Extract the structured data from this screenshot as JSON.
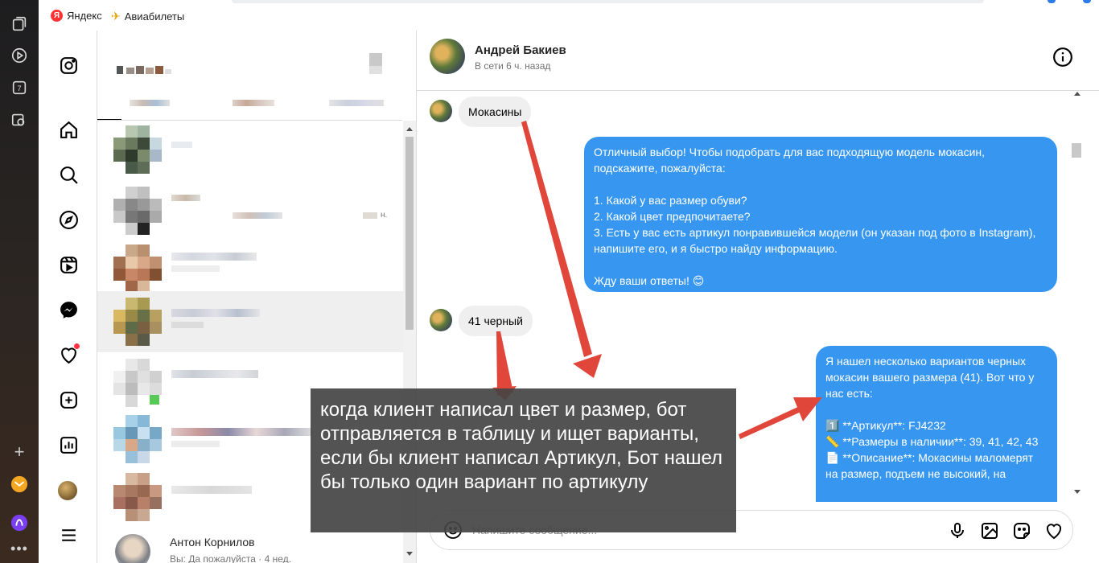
{
  "bookmarks": [
    {
      "label": "Яндекс",
      "icon": "yandex-logo-icon"
    },
    {
      "label": "Авиабилеты",
      "icon": "airplane-icon"
    }
  ],
  "chat": {
    "contact_name": "Андрей Бакиев",
    "contact_status": "В сети 6 ч. назад",
    "messages": [
      {
        "direction": "in",
        "text": "Мокасины"
      },
      {
        "direction": "out",
        "text": "Отличный выбор! Чтобы подобрать для вас подходящую модель мокасин, подскажите, пожалуйста:\n\n1. Какой у вас размер обуви?\n2. Какой цвет предпочитаете?\n3. Есть у вас есть артикул понравившейся модели (он указан под фото в Instagram), напишите его, и я быстро найду информацию.\n\nЖду ваши ответы! 😊"
      },
      {
        "direction": "in",
        "text": "41 черный"
      },
      {
        "direction": "out",
        "text": "Я нашел несколько вариантов черных мокасин вашего размера (41). Вот что у нас есть:\n\n1️⃣ **Артикул**: FJ4232\n📏 **Размеры в наличии**: 39, 41, 42, 43\n📄 **Описание**: Мокасины маломерят на размер, подъем не высокий, на"
      }
    ],
    "composer_placeholder": "Напишите сообщение..."
  },
  "conversation_list": {
    "visible_item_name": "Антон Корнилов",
    "visible_item_preview": "Вы: Да пожалуйста · 4 нед.",
    "time_badge": "н."
  },
  "annotation": {
    "text": "когда клиент написал цвет и размер, бот отправляется в таблицу и ищет варианты, если бы клиент написал Артикул, Бот нашел бы только один вариант по артикулу"
  },
  "colors": {
    "outgoing_bubble": "#3797f0",
    "incoming_bubble": "#efefef",
    "annotation_bg": "#444444",
    "arrow": "#e0473a"
  }
}
